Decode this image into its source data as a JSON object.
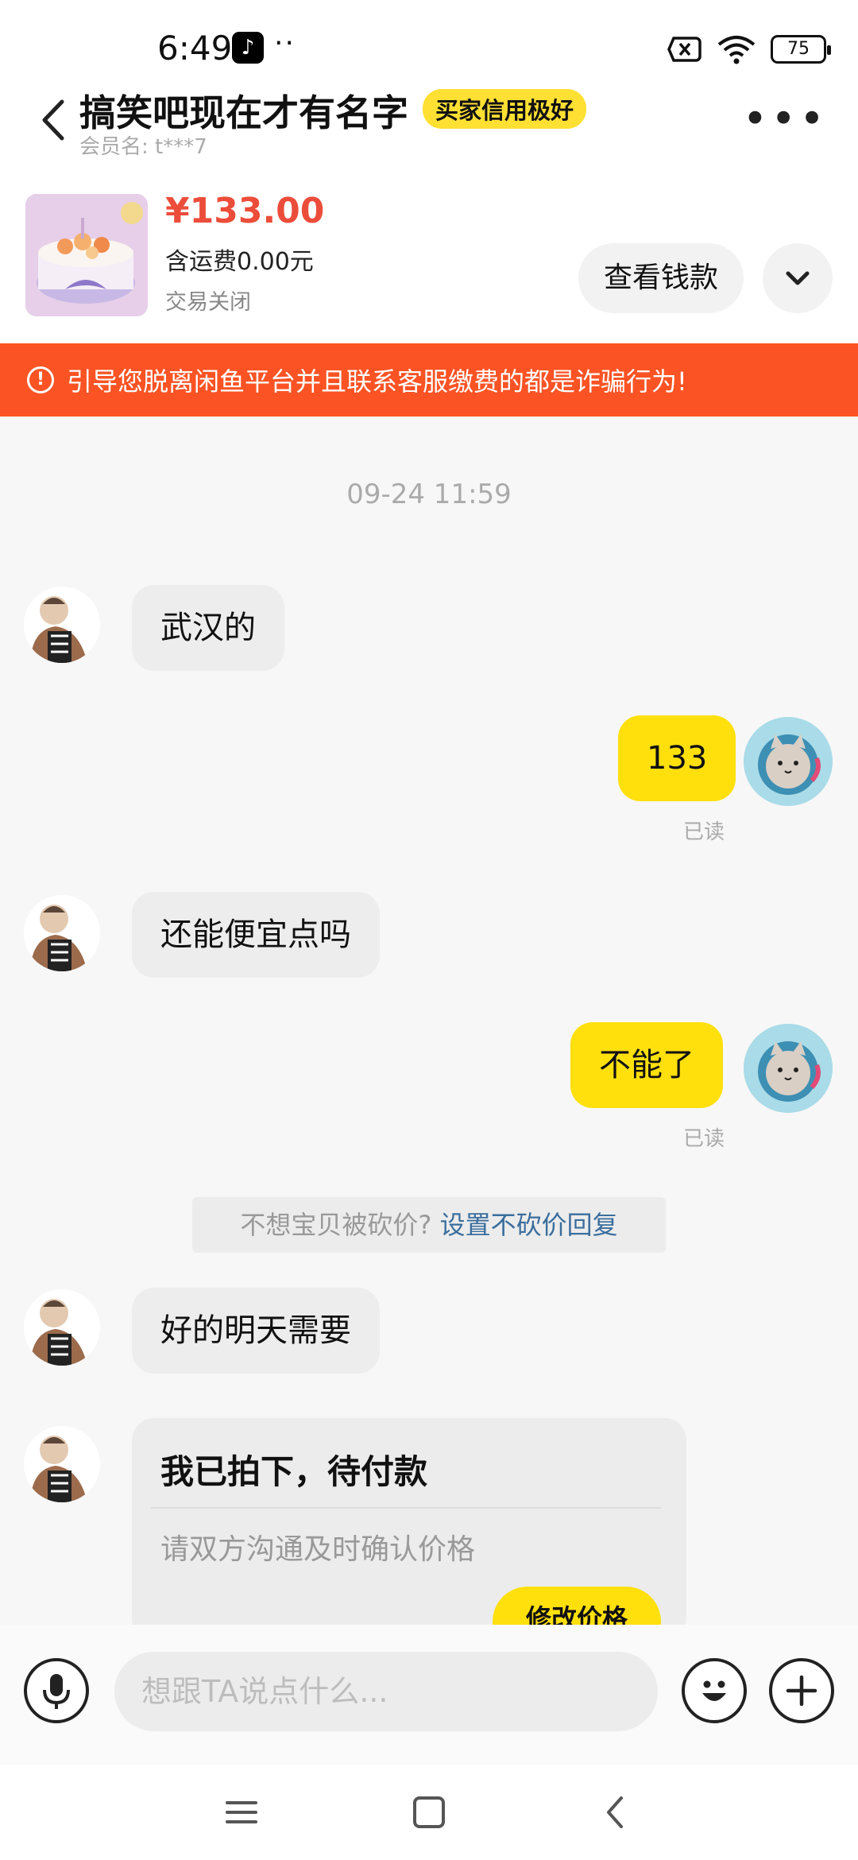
{
  "status_bar": {
    "time": "6:49",
    "battery": "75"
  },
  "header": {
    "title": "搞笑吧现在才有名字",
    "badge": "买家信用极好",
    "member_label": "会员名: t***7"
  },
  "product": {
    "price": "¥133.00",
    "shipping": "含运费0.00元",
    "status": "交易关闭",
    "view_button": "查看钱款"
  },
  "warning": {
    "text": "引导您脱离闲鱼平台并且联系客服缴费的都是诈骗行为!"
  },
  "chat": {
    "timestamp": "09-24 11:59",
    "messages": [
      {
        "from": "other",
        "text": "武汉的"
      },
      {
        "from": "me",
        "text": "133",
        "read": "已读"
      },
      {
        "from": "other",
        "text": "还能便宜点吗"
      },
      {
        "from": "me",
        "text": "不能了",
        "read": "已读"
      },
      {
        "from": "other",
        "text": "好的明天需要"
      }
    ],
    "tip": {
      "text": "不想宝贝被砍价? ",
      "link": "设置不砍价回复"
    },
    "order_card": {
      "title": "我已拍下，待付款",
      "subtitle": "请双方沟通及时确认价格",
      "button": "修改价格"
    }
  },
  "input": {
    "placeholder": "想跟TA说点什么..."
  },
  "colors": {
    "accent_yellow": "#ffe00d",
    "warning_orange": "#fc5324",
    "price_red": "#ec4d3b",
    "link_blue": "#3a6e9d"
  },
  "icons": [
    "back-icon",
    "more-icon",
    "chevron-down-icon",
    "alert-icon",
    "mic-icon",
    "emoji-icon",
    "plus-icon",
    "menu-icon",
    "home-icon",
    "back-nav-icon"
  ]
}
